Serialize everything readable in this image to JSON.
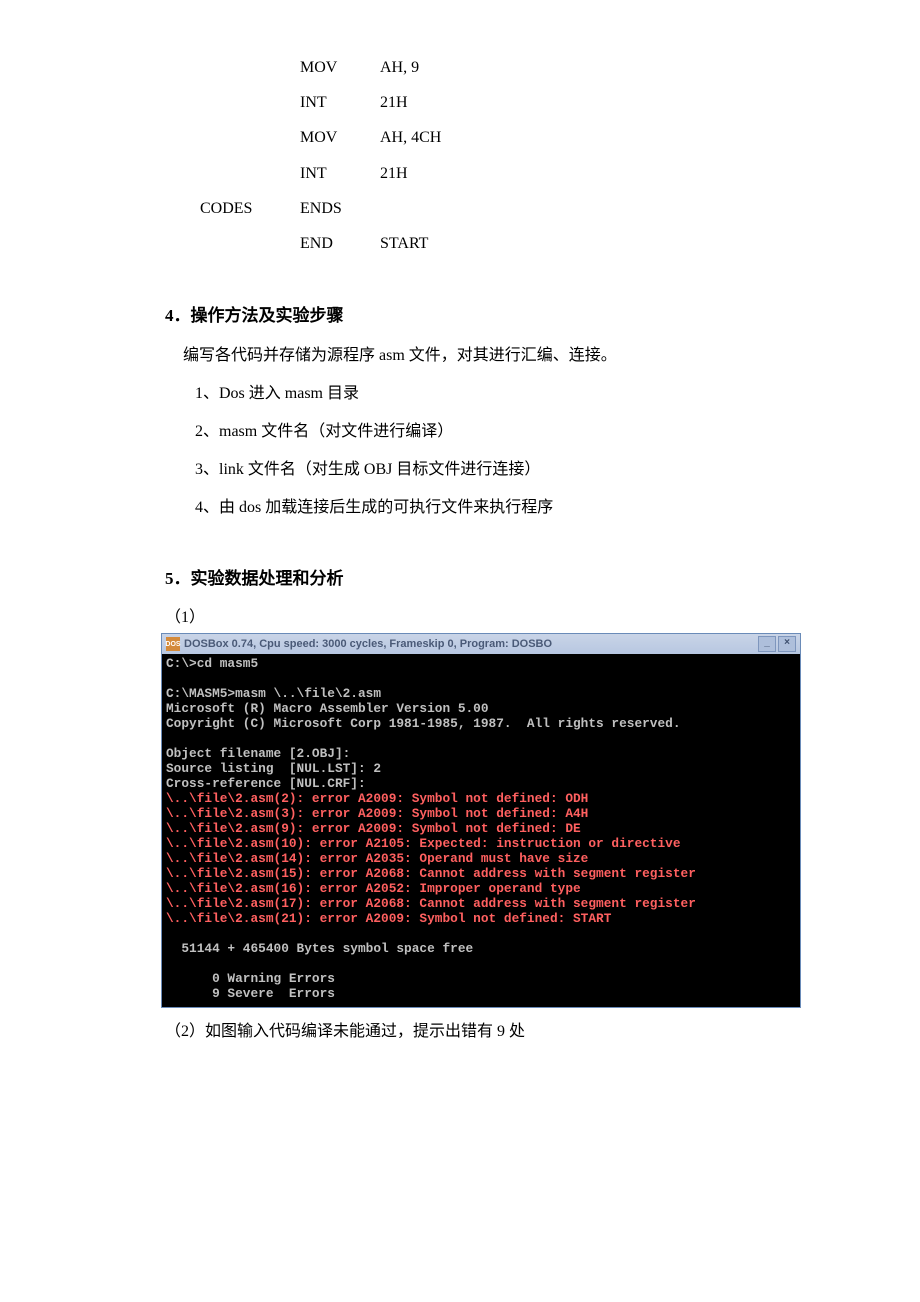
{
  "code_lines": [
    {
      "label": "",
      "op": "MOV",
      "arg": "AH, 9"
    },
    {
      "label": "",
      "op": "INT",
      "arg": "21H"
    },
    {
      "label": "",
      "op": "MOV",
      "arg": "AH, 4CH"
    },
    {
      "label": "",
      "op": "INT",
      "arg": "21H"
    },
    {
      "label": "CODES",
      "op": "ENDS",
      "arg": ""
    },
    {
      "label": "",
      "op": "END",
      "arg": "START"
    }
  ],
  "section4": {
    "heading": "4．操作方法及实验步骤",
    "intro": "编写各代码并存储为源程序 asm 文件，对其进行汇编、连接。",
    "steps": [
      "1、Dos 进入 masm 目录",
      "2、masm 文件名（对文件进行编译）",
      "3、link 文件名（对生成 OBJ 目标文件进行连接）",
      "4、由 dos 加载连接后生成的可执行文件来执行程序"
    ]
  },
  "section5": {
    "heading": "5．实验数据处理和分析",
    "sub1_label": "（1）",
    "sub2_text": "（2）如图输入代码编译未能通过，提示出错有 9 处"
  },
  "dosbox": {
    "icon_text": "DOS",
    "title": "DOSBox 0.74, Cpu speed:    3000 cycles, Frameskip  0, Program:   DOSBO",
    "min": "_",
    "close": "×",
    "body_lines": [
      {
        "cls": "dos-cmd",
        "text": "C:\\>cd masm5"
      },
      {
        "cls": "dos-cmd",
        "text": ""
      },
      {
        "cls": "dos-cmd",
        "text": "C:\\MASM5>masm \\..\\file\\2.asm"
      },
      {
        "cls": "dos-cmd",
        "text": "Microsoft (R) Macro Assembler Version 5.00"
      },
      {
        "cls": "dos-cmd",
        "text": "Copyright (C) Microsoft Corp 1981-1985, 1987.  All rights reserved."
      },
      {
        "cls": "dos-cmd",
        "text": ""
      },
      {
        "cls": "dos-cmd",
        "text": "Object filename [2.OBJ]:"
      },
      {
        "cls": "dos-cmd",
        "text": "Source listing  [NUL.LST]: 2"
      },
      {
        "cls": "dos-cmd",
        "text": "Cross-reference [NUL.CRF]:"
      },
      {
        "cls": "dos-err",
        "text": "\\..\\file\\2.asm(2): error A2009: Symbol not defined: ODH"
      },
      {
        "cls": "dos-err",
        "text": "\\..\\file\\2.asm(3): error A2009: Symbol not defined: A4H"
      },
      {
        "cls": "dos-err",
        "text": "\\..\\file\\2.asm(9): error A2009: Symbol not defined: DE"
      },
      {
        "cls": "dos-err",
        "text": "\\..\\file\\2.asm(10): error A2105: Expected: instruction or directive"
      },
      {
        "cls": "dos-err",
        "text": "\\..\\file\\2.asm(14): error A2035: Operand must have size"
      },
      {
        "cls": "dos-err",
        "text": "\\..\\file\\2.asm(15): error A2068: Cannot address with segment register"
      },
      {
        "cls": "dos-err",
        "text": "\\..\\file\\2.asm(16): error A2052: Improper operand type"
      },
      {
        "cls": "dos-err",
        "text": "\\..\\file\\2.asm(17): error A2068: Cannot address with segment register"
      },
      {
        "cls": "dos-err",
        "text": "\\..\\file\\2.asm(21): error A2009: Symbol not defined: START"
      },
      {
        "cls": "dos-cmd",
        "text": ""
      },
      {
        "cls": "dos-cmd",
        "text": "  51144 + 465400 Bytes symbol space free"
      },
      {
        "cls": "dos-cmd",
        "text": ""
      },
      {
        "cls": "dos-cmd",
        "text": "      0 Warning Errors"
      },
      {
        "cls": "dos-cmd",
        "text": "      9 Severe  Errors"
      }
    ]
  }
}
